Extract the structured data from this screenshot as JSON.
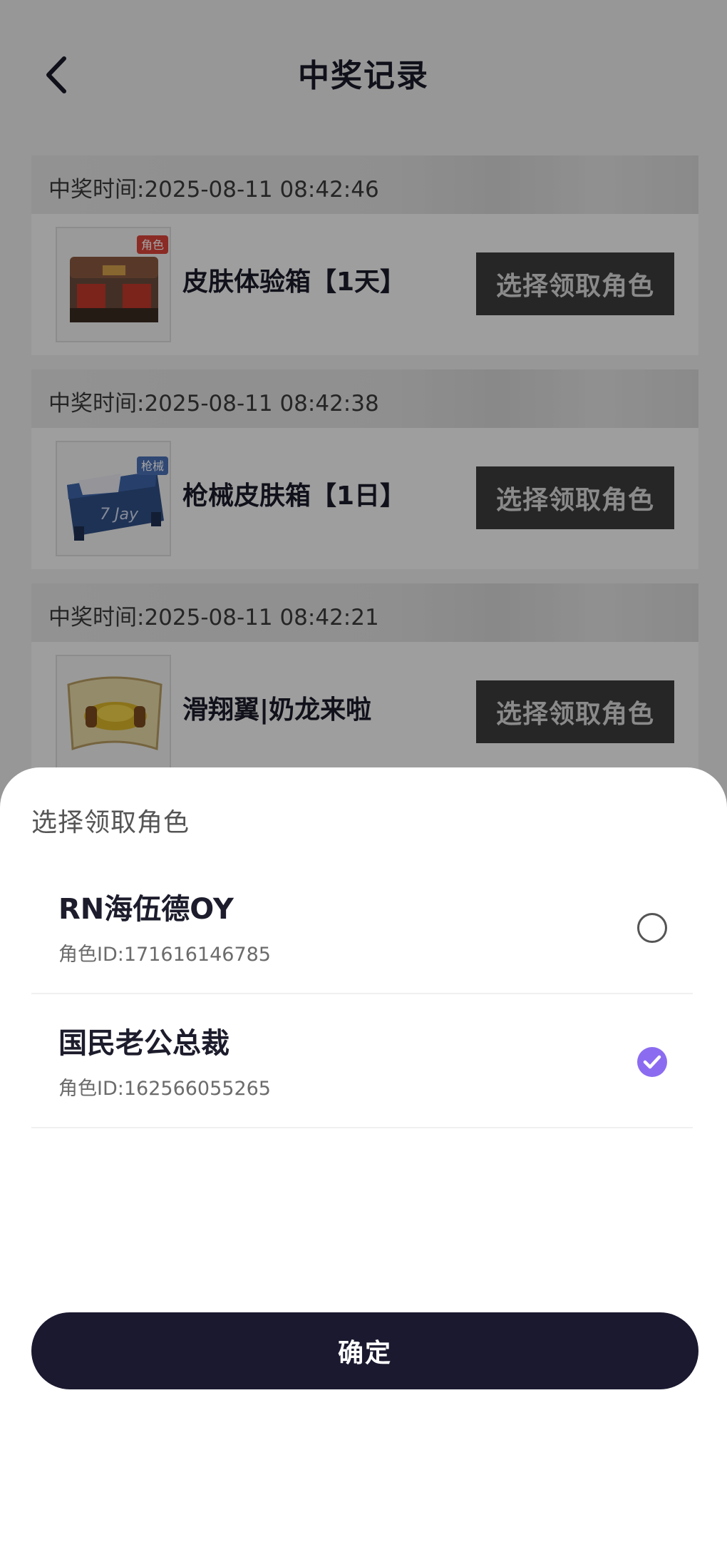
{
  "header": {
    "title": "中奖记录",
    "back_icon": "chevron-left-icon"
  },
  "records": [
    {
      "time": "中奖时间:2025-08-11 08:42:46",
      "name": "皮肤体验箱【1天】",
      "tag": "角色",
      "icon": "skin-chest-icon",
      "action": "选择领取角色"
    },
    {
      "time": "中奖时间:2025-08-11 08:42:38",
      "name": "枪械皮肤箱【1日】",
      "tag": "枪械",
      "icon": "gun-skin-chest-icon",
      "action": "选择领取角色"
    },
    {
      "time": "中奖时间:2025-08-11 08:42:21",
      "name": "滑翔翼|奶龙来啦",
      "tag": "",
      "icon": "glider-scroll-icon",
      "action": "选择领取角色"
    }
  ],
  "sheet": {
    "title": "选择领取角色",
    "roles": [
      {
        "name": "RN海伍德OY",
        "id": "角色ID:171616146785",
        "selected": false
      },
      {
        "name": "国民老公总裁",
        "id": "角色ID:162566055265",
        "selected": true
      }
    ],
    "confirm_label": "确定",
    "accent_color": "#8b6cf0",
    "button_color": "#1b1930"
  }
}
